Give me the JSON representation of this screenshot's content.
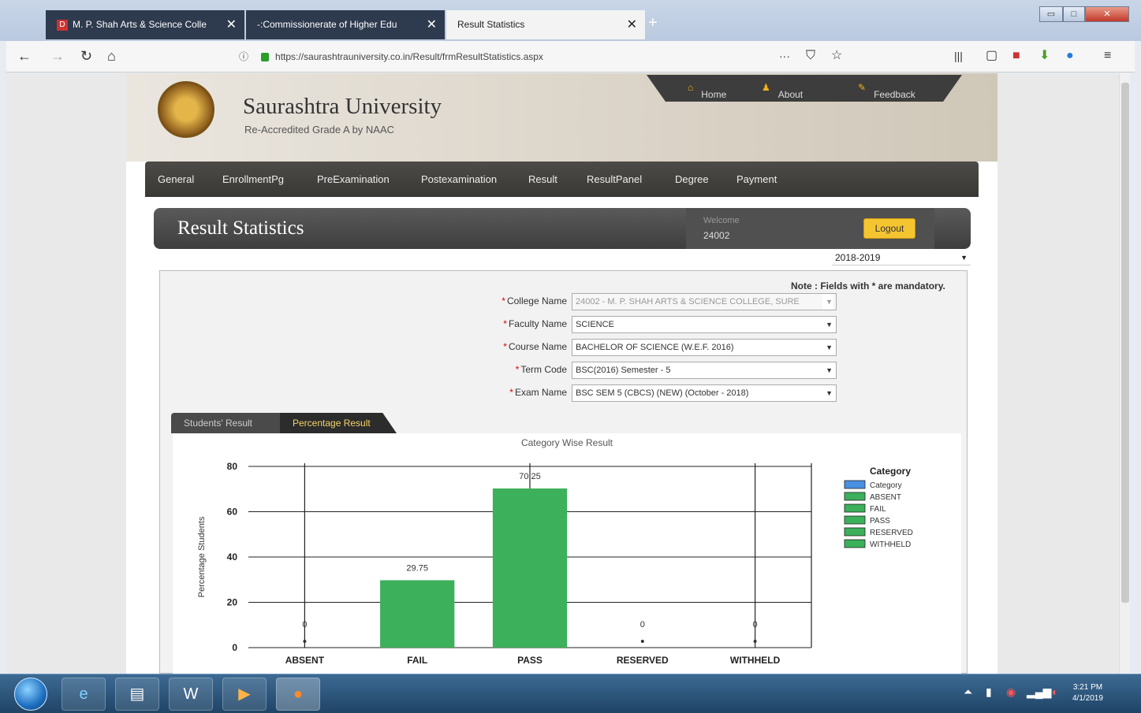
{
  "browser": {
    "tabs": [
      {
        "label": "M. P. Shah Arts & Science Colle",
        "favicon": "D"
      },
      {
        "label": "-:Commissionerate of Higher Edu",
        "favicon": ""
      },
      {
        "label": "Result Statistics",
        "favicon": ""
      }
    ],
    "url": "https://saurashtrauniversity.co.in/Result/frmResultStatistics.aspx",
    "more": "···",
    "win_min": "▭",
    "win_max": "□",
    "win_close": "✕"
  },
  "site": {
    "name": "Saurashtra University",
    "tagline": "Re-Accredited Grade A by NAAC",
    "toplinks": [
      "Home",
      "About Us",
      "Feedback"
    ],
    "menu": [
      "General",
      "EnrollmentPg",
      "PreExamination",
      "Postexamination",
      "Result",
      "ResultPanel",
      "Degree",
      "Payment"
    ]
  },
  "page": {
    "title": "Result Statistics",
    "welcome_label": "Welcome",
    "user": "24002",
    "logout": "Logout",
    "year": "2018-2019",
    "note": "Note : Fields with * are mandatory.",
    "fields": [
      {
        "label": "College Name",
        "value": "24002 - M. P. SHAH ARTS & SCIENCE COLLEGE, SURE",
        "disabled": true
      },
      {
        "label": "Faculty Name",
        "value": "SCIENCE",
        "disabled": false
      },
      {
        "label": "Course Name",
        "value": "BACHELOR OF SCIENCE (W.E.F. 2016)",
        "disabled": false
      },
      {
        "label": "Term Code",
        "value": "BSC(2016) Semester - 5",
        "disabled": false
      },
      {
        "label": "Exam Name",
        "value": "BSC SEM 5 (CBCS) (NEW) (October - 2018)",
        "disabled": false
      }
    ],
    "result_tabs": [
      "Students' Result",
      "Percentage Result"
    ]
  },
  "chart_data": {
    "type": "bar",
    "title": "Category Wise Result",
    "ylabel": "Percentage Students",
    "xlabel": "",
    "categories": [
      "ABSENT",
      "FAIL",
      "PASS",
      "RESERVED",
      "WITHHELD"
    ],
    "values": [
      0,
      29.75,
      70.25,
      0,
      0
    ],
    "value_labels": [
      "0",
      "29.75",
      "70.25",
      "0",
      "0"
    ],
    "ylim": [
      0,
      80
    ],
    "yticks": [
      0,
      20,
      40,
      60,
      80
    ],
    "grid": true,
    "bar_color": "#3cb05a",
    "legend": {
      "title": "Category",
      "position": "right",
      "entries": [
        {
          "name": "Category",
          "color": "#4a90e2"
        },
        {
          "name": "ABSENT",
          "color": "#3cb05a"
        },
        {
          "name": "FAIL",
          "color": "#3cb05a"
        },
        {
          "name": "PASS",
          "color": "#3cb05a"
        },
        {
          "name": "RESERVED",
          "color": "#3cb05a"
        },
        {
          "name": "WITHHELD",
          "color": "#3cb05a"
        }
      ]
    }
  },
  "taskbar": {
    "clock_time": "3:21 PM",
    "clock_date": "4/1/2019"
  }
}
